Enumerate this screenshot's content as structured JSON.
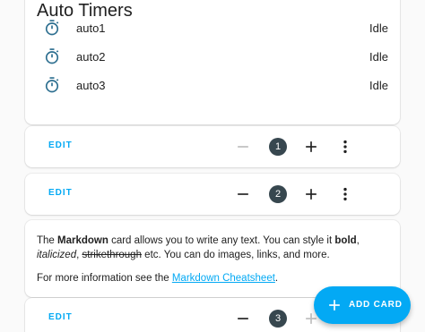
{
  "entities_card": {
    "title": "Auto Timers",
    "icon": "timer-icon",
    "rows": [
      {
        "name": "auto1",
        "state": "Idle"
      },
      {
        "name": "auto2",
        "state": "Idle"
      },
      {
        "name": "auto3",
        "state": "Idle"
      }
    ]
  },
  "edit_bars": [
    {
      "edit_label": "EDIT",
      "position": "1",
      "move_up_enabled": false
    },
    {
      "edit_label": "EDIT",
      "position": "2",
      "move_up_enabled": true
    },
    {
      "edit_label": "EDIT",
      "position": "3",
      "move_up_enabled": true
    }
  ],
  "markdown_card": {
    "p1_prefix": "The ",
    "p1_bold1": "Markdown",
    "p1_mid1": " card allows you to write any text. You can style it ",
    "p1_bold2": "bold",
    "p1_mid2": ",",
    "p1_italic": "italicized",
    "p1_mid3": ", ",
    "p1_strike": "strikethrough",
    "p1_suffix": " etc. You can do images, links, and more.",
    "p2_prefix": "For more information see the ",
    "p2_link": "Markdown Cheatsheet",
    "p2_suffix": "."
  },
  "fab": {
    "label": "ADD CARD",
    "icon": "plus-icon"
  },
  "colors": {
    "accent": "#03a9f4",
    "badge": "#37474f",
    "icon": "#2c6e8f",
    "disabled": "#bdbdbd"
  }
}
